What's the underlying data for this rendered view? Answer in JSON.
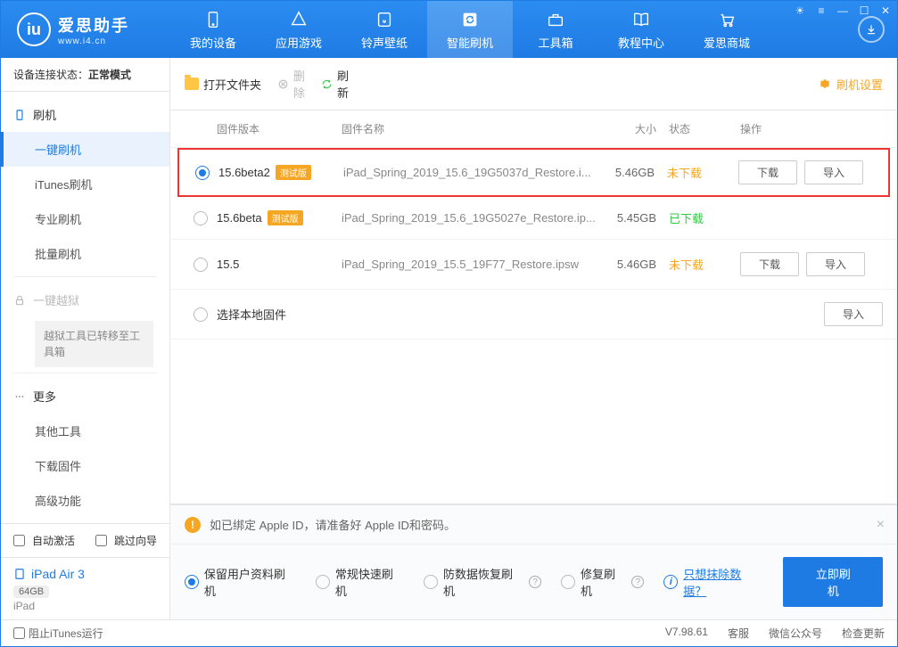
{
  "logo": {
    "title": "爱思助手",
    "url": "www.i4.cn"
  },
  "nav": [
    {
      "label": "我的设备"
    },
    {
      "label": "应用游戏"
    },
    {
      "label": "铃声壁纸"
    },
    {
      "label": "智能刷机"
    },
    {
      "label": "工具箱"
    },
    {
      "label": "教程中心"
    },
    {
      "label": "爱思商城"
    }
  ],
  "status": {
    "prefix": "设备连接状态：",
    "value": "正常模式"
  },
  "sidebar": {
    "flash_head": "刷机",
    "items": [
      "一键刷机",
      "iTunes刷机",
      "专业刷机",
      "批量刷机"
    ],
    "jailbreak_head": "一键越狱",
    "jailbreak_note": "越狱工具已转移至工具箱",
    "more_head": "更多",
    "more_items": [
      "其他工具",
      "下载固件",
      "高级功能"
    ],
    "auto_activate": "自动激活",
    "skip_guide": "跳过向导",
    "device_name": "iPad Air 3",
    "device_storage": "64GB",
    "device_type": "iPad"
  },
  "toolbar": {
    "open": "打开文件夹",
    "delete": "删除",
    "refresh": "刷新",
    "settings": "刷机设置"
  },
  "columns": {
    "ver": "固件版本",
    "name": "固件名称",
    "size": "大小",
    "status": "状态",
    "ops": "操作"
  },
  "firmware": [
    {
      "ver": "15.6beta2",
      "beta": "测试版",
      "name": "iPad_Spring_2019_15.6_19G5037d_Restore.i...",
      "size": "5.46GB",
      "status": "未下载",
      "status_cls": "st-orange",
      "selected": true,
      "download": "下载",
      "import": "导入",
      "highlight": true
    },
    {
      "ver": "15.6beta",
      "beta": "测试版",
      "name": "iPad_Spring_2019_15.6_19G5027e_Restore.ip...",
      "size": "5.45GB",
      "status": "已下载",
      "status_cls": "st-green",
      "selected": false
    },
    {
      "ver": "15.5",
      "beta": "",
      "name": "iPad_Spring_2019_15.5_19F77_Restore.ipsw",
      "size": "5.46GB",
      "status": "未下载",
      "status_cls": "st-orange",
      "selected": false,
      "download": "下载",
      "import": "导入"
    }
  ],
  "local_row": {
    "label": "选择本地固件",
    "import": "导入"
  },
  "warning": "如已绑定 Apple ID，请准备好 Apple ID和密码。",
  "options": {
    "o1": "保留用户资料刷机",
    "o2": "常规快速刷机",
    "o3": "防数据恢复刷机",
    "o4": "修复刷机",
    "erase": "只想抹除数据？",
    "flash_btn": "立即刷机"
  },
  "footer": {
    "block_itunes": "阻止iTunes运行",
    "version": "V7.98.61",
    "support": "客服",
    "wechat": "微信公众号",
    "update": "检查更新"
  }
}
